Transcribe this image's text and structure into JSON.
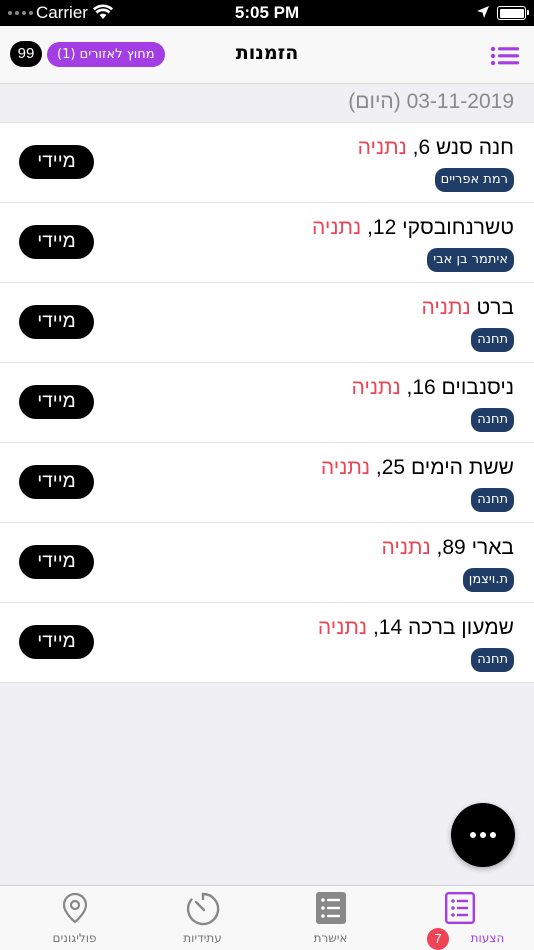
{
  "status_bar": {
    "carrier": "Carrier",
    "time": "5:05 PM"
  },
  "nav": {
    "title": "הזמנות",
    "orders_count": "99",
    "zone_filter": "מחוץ לאזורים (1)"
  },
  "date_header": "03-11-2019 (היום)",
  "orders": [
    {
      "street": "חנה סנש 6,",
      "city": "נתניה",
      "tag": "רמת אפריים",
      "action": "מיידי"
    },
    {
      "street": "טשרנחובסקי 12,",
      "city": "נתניה",
      "tag": "איתמר בן אבי",
      "action": "מיידי"
    },
    {
      "street": "ברט",
      "city": "נתניה",
      "tag": "תחנה",
      "action": "מיידי"
    },
    {
      "street": "ניסנבוים 16,",
      "city": "נתניה",
      "tag": "תחנה",
      "action": "מיידי"
    },
    {
      "street": "ששת הימים 25,",
      "city": "נתניה",
      "tag": "תחנה",
      "action": "מיידי"
    },
    {
      "street": "בארי 89,",
      "city": "נתניה",
      "tag": "ת.ויצמן",
      "action": "מיידי"
    },
    {
      "street": "שמעון ברכה 14,",
      "city": "נתניה",
      "tag": "תחנה",
      "action": "מיידי"
    }
  ],
  "tabs": [
    {
      "label": "פוליגונים",
      "icon": "location-pin-icon"
    },
    {
      "label": "עתידיות",
      "icon": "timer-icon"
    },
    {
      "label": "אישרת",
      "icon": "list-icon"
    },
    {
      "label": "הצעות",
      "icon": "list-icon",
      "badge": "7",
      "active": true
    }
  ],
  "colors": {
    "accent_purple": "#a33ee5",
    "city_red": "#ee4455",
    "tag_navy": "#1f3d66",
    "badge_red": "#ee4455"
  }
}
